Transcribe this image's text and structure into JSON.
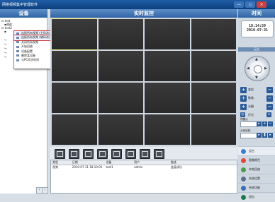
{
  "window": {
    "title": "网络视频集中管理软件"
  },
  "headers": {
    "devices": "设备",
    "live": "实时监控",
    "time": "时间"
  },
  "tree": [
    {
      "label": "test"
    },
    {
      "label": "通道"
    },
    {
      "label": "test2"
    }
  ],
  "context_menu": [
    "连接所有视频 (主码流)",
    "连接所有视频 (辅码流)",
    "关闭所有视频",
    "开始回放",
    "设备配置",
    "删除某设备",
    "与PC同步时间"
  ],
  "clock": {
    "time": "18:14:59",
    "date": "2010-07-31"
  },
  "ptz": {
    "title": "云台",
    "zoom": "变倍",
    "focus": "聚焦",
    "iris": "光圈",
    "light": "灯光",
    "preset_label": "预置点",
    "cruise_label": "点间巡航"
  },
  "log": {
    "columns": [
      "类型",
      "日期",
      "设备",
      "用户",
      "描述"
    ],
    "rows": [
      [
        "视频",
        "2010-07-31 18:10:01",
        "test1",
        "admin",
        "连接成功"
      ]
    ]
  },
  "menu": [
    "云台",
    "图像颜色",
    "本地回放",
    "系统设置",
    "系统功能",
    "退出"
  ],
  "colors": {
    "title_bar": "#0d3f7d",
    "header": "#2f63a3",
    "video_cell": "#2f2f2f"
  }
}
